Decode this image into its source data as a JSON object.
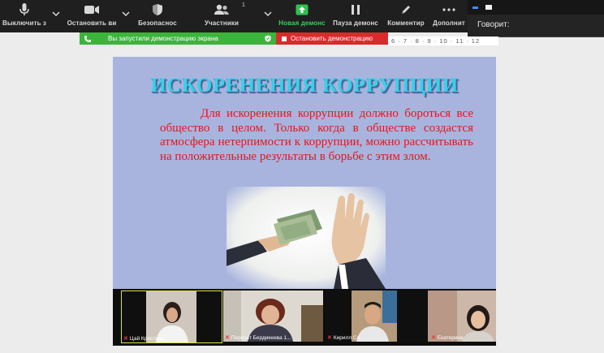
{
  "toolbar": {
    "mute_label": "Выключить з",
    "video_label": "Остановить ви",
    "security_label": "Безопаснос",
    "participants_label": "Участники",
    "participants_count": "1",
    "share_label": "Новая демонс",
    "pause_label": "Пауза демонс",
    "annotate_label": "Комментир",
    "more_label": "Дополнит"
  },
  "speaking_panel": {
    "label": "Говорит:"
  },
  "share_banner": {
    "status": "Вы запустили демонстрацию экрана",
    "stop_label": "Остановить демонстрацию"
  },
  "ruler": {
    "text": "6 · 7 · 8 · 9 · 10 · 11 · 12"
  },
  "slide": {
    "title": "ИСКОРЕНЕНИЯ КОРРУПЦИИ",
    "body": "Для искоренения коррупции должно бороться все общество в целом. Только когда в обществе создастся атмосфера нетерпимости к коррупции, можно рассчитывать на положительные результаты в борьбе с этим злом."
  },
  "participants": [
    {
      "name": "Цай Кристина"
    },
    {
      "name": "Перизат Бердикеева 1..."
    },
    {
      "name": "Кирилл Со"
    },
    {
      "name": "Екатерина"
    }
  ],
  "colors": {
    "toolbar_bg": "#1f1f1f",
    "share_green": "#3cb43c",
    "stop_red": "#d92b2b",
    "slide_bg": "#a8b4de",
    "title_cyan": "#3ad0e8",
    "body_red": "#e01919"
  }
}
